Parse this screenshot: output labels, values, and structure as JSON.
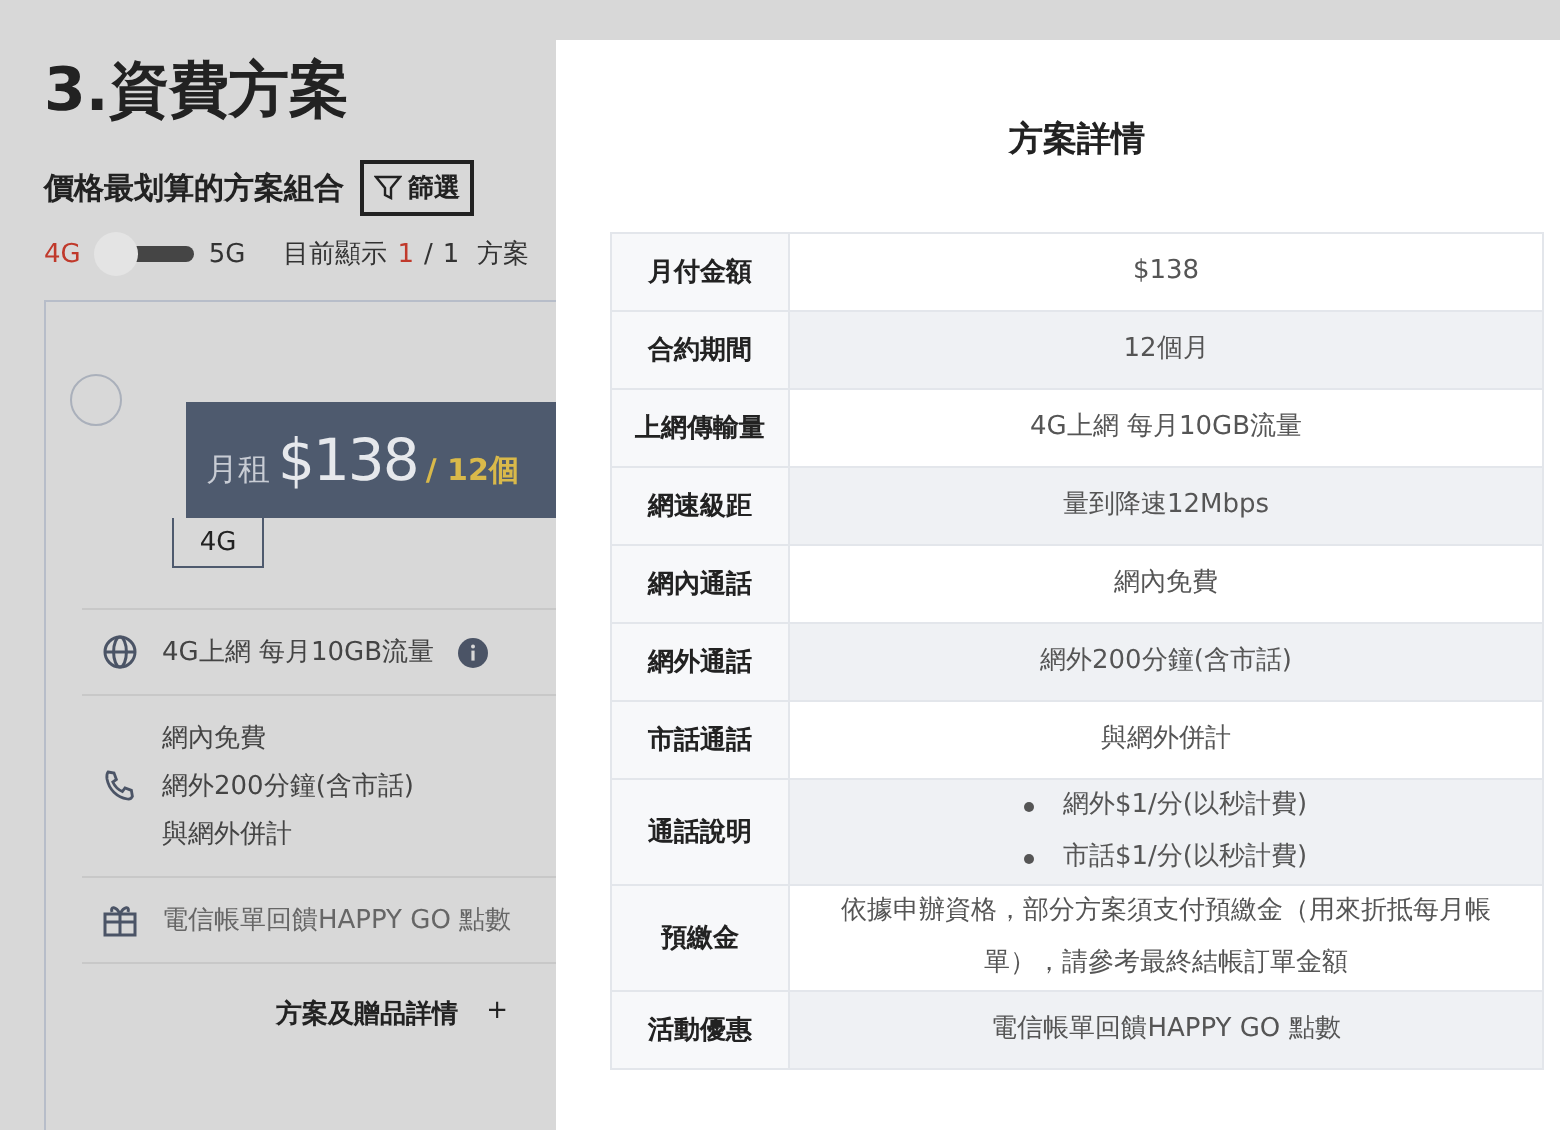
{
  "page": {
    "title": "3.資費方案",
    "subtitle": "價格最划算的方案組合",
    "filter_button": "篩選",
    "network_toggle": [
      {
        "label": "4G",
        "selected": true
      },
      {
        "label": "5G",
        "selected": false
      }
    ],
    "count": {
      "label": "目前顯示",
      "shown": "1",
      "separator": "/",
      "total": "1",
      "unit": "方案"
    },
    "plan": {
      "selected": false,
      "price_label": "月租",
      "price": "$138",
      "period": "/ 12個",
      "network_tag": "4G",
      "features": [
        {
          "kind": "globe",
          "lines": [
            "4G上網 每月10GB流量"
          ],
          "info": true
        },
        {
          "kind": "phone",
          "lines": [
            "網內免費",
            "網外200分鐘(含市話)",
            "與網外併計"
          ],
          "info": false
        },
        {
          "kind": "gift",
          "lines": [
            "電信帳單回饋HAPPY GO 點數"
          ],
          "info": false
        }
      ],
      "details_link": "方案及贈品詳情",
      "expand_sign": "+"
    }
  },
  "dialog": {
    "title": "方案詳情",
    "rows": [
      {
        "label": "月付金額",
        "value": "$138"
      },
      {
        "label": "合約期間",
        "value": "12個月"
      },
      {
        "label": "上網傳輸量",
        "value": "4G上網 每月10GB流量"
      },
      {
        "label": "網速級距",
        "value": "量到降速12Mbps"
      },
      {
        "label": "網內通話",
        "value": "網內免費"
      },
      {
        "label": "網外通話",
        "value": "網外200分鐘(含市話)"
      },
      {
        "label": "市話通話",
        "value": "與網外併計"
      },
      {
        "label": "通話說明",
        "bullets": [
          "網外$1/分(以秒計費)",
          "市話$1/分(以秒計費)"
        ]
      },
      {
        "label": "預繳金",
        "value": "依據申辦資格，部分方案須支付預繳金（用來折抵每月帳單），請參考最終結帳訂單金額"
      },
      {
        "label": "活動優惠",
        "value": "電信帳單回饋HAPPY GO 點數"
      }
    ]
  }
}
